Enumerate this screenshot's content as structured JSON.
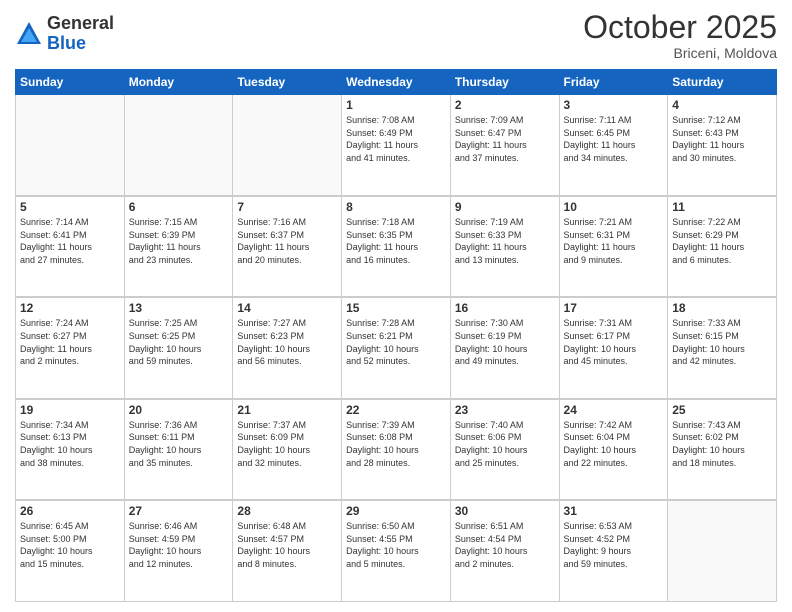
{
  "logo": {
    "general": "General",
    "blue": "Blue"
  },
  "title": "October 2025",
  "location": "Briceni, Moldova",
  "days_of_week": [
    "Sunday",
    "Monday",
    "Tuesday",
    "Wednesday",
    "Thursday",
    "Friday",
    "Saturday"
  ],
  "weeks": [
    [
      {
        "day": "",
        "info": ""
      },
      {
        "day": "",
        "info": ""
      },
      {
        "day": "",
        "info": ""
      },
      {
        "day": "1",
        "info": "Sunrise: 7:08 AM\nSunset: 6:49 PM\nDaylight: 11 hours\nand 41 minutes."
      },
      {
        "day": "2",
        "info": "Sunrise: 7:09 AM\nSunset: 6:47 PM\nDaylight: 11 hours\nand 37 minutes."
      },
      {
        "day": "3",
        "info": "Sunrise: 7:11 AM\nSunset: 6:45 PM\nDaylight: 11 hours\nand 34 minutes."
      },
      {
        "day": "4",
        "info": "Sunrise: 7:12 AM\nSunset: 6:43 PM\nDaylight: 11 hours\nand 30 minutes."
      }
    ],
    [
      {
        "day": "5",
        "info": "Sunrise: 7:14 AM\nSunset: 6:41 PM\nDaylight: 11 hours\nand 27 minutes."
      },
      {
        "day": "6",
        "info": "Sunrise: 7:15 AM\nSunset: 6:39 PM\nDaylight: 11 hours\nand 23 minutes."
      },
      {
        "day": "7",
        "info": "Sunrise: 7:16 AM\nSunset: 6:37 PM\nDaylight: 11 hours\nand 20 minutes."
      },
      {
        "day": "8",
        "info": "Sunrise: 7:18 AM\nSunset: 6:35 PM\nDaylight: 11 hours\nand 16 minutes."
      },
      {
        "day": "9",
        "info": "Sunrise: 7:19 AM\nSunset: 6:33 PM\nDaylight: 11 hours\nand 13 minutes."
      },
      {
        "day": "10",
        "info": "Sunrise: 7:21 AM\nSunset: 6:31 PM\nDaylight: 11 hours\nand 9 minutes."
      },
      {
        "day": "11",
        "info": "Sunrise: 7:22 AM\nSunset: 6:29 PM\nDaylight: 11 hours\nand 6 minutes."
      }
    ],
    [
      {
        "day": "12",
        "info": "Sunrise: 7:24 AM\nSunset: 6:27 PM\nDaylight: 11 hours\nand 2 minutes."
      },
      {
        "day": "13",
        "info": "Sunrise: 7:25 AM\nSunset: 6:25 PM\nDaylight: 10 hours\nand 59 minutes."
      },
      {
        "day": "14",
        "info": "Sunrise: 7:27 AM\nSunset: 6:23 PM\nDaylight: 10 hours\nand 56 minutes."
      },
      {
        "day": "15",
        "info": "Sunrise: 7:28 AM\nSunset: 6:21 PM\nDaylight: 10 hours\nand 52 minutes."
      },
      {
        "day": "16",
        "info": "Sunrise: 7:30 AM\nSunset: 6:19 PM\nDaylight: 10 hours\nand 49 minutes."
      },
      {
        "day": "17",
        "info": "Sunrise: 7:31 AM\nSunset: 6:17 PM\nDaylight: 10 hours\nand 45 minutes."
      },
      {
        "day": "18",
        "info": "Sunrise: 7:33 AM\nSunset: 6:15 PM\nDaylight: 10 hours\nand 42 minutes."
      }
    ],
    [
      {
        "day": "19",
        "info": "Sunrise: 7:34 AM\nSunset: 6:13 PM\nDaylight: 10 hours\nand 38 minutes."
      },
      {
        "day": "20",
        "info": "Sunrise: 7:36 AM\nSunset: 6:11 PM\nDaylight: 10 hours\nand 35 minutes."
      },
      {
        "day": "21",
        "info": "Sunrise: 7:37 AM\nSunset: 6:09 PM\nDaylight: 10 hours\nand 32 minutes."
      },
      {
        "day": "22",
        "info": "Sunrise: 7:39 AM\nSunset: 6:08 PM\nDaylight: 10 hours\nand 28 minutes."
      },
      {
        "day": "23",
        "info": "Sunrise: 7:40 AM\nSunset: 6:06 PM\nDaylight: 10 hours\nand 25 minutes."
      },
      {
        "day": "24",
        "info": "Sunrise: 7:42 AM\nSunset: 6:04 PM\nDaylight: 10 hours\nand 22 minutes."
      },
      {
        "day": "25",
        "info": "Sunrise: 7:43 AM\nSunset: 6:02 PM\nDaylight: 10 hours\nand 18 minutes."
      }
    ],
    [
      {
        "day": "26",
        "info": "Sunrise: 6:45 AM\nSunset: 5:00 PM\nDaylight: 10 hours\nand 15 minutes."
      },
      {
        "day": "27",
        "info": "Sunrise: 6:46 AM\nSunset: 4:59 PM\nDaylight: 10 hours\nand 12 minutes."
      },
      {
        "day": "28",
        "info": "Sunrise: 6:48 AM\nSunset: 4:57 PM\nDaylight: 10 hours\nand 8 minutes."
      },
      {
        "day": "29",
        "info": "Sunrise: 6:50 AM\nSunset: 4:55 PM\nDaylight: 10 hours\nand 5 minutes."
      },
      {
        "day": "30",
        "info": "Sunrise: 6:51 AM\nSunset: 4:54 PM\nDaylight: 10 hours\nand 2 minutes."
      },
      {
        "day": "31",
        "info": "Sunrise: 6:53 AM\nSunset: 4:52 PM\nDaylight: 9 hours\nand 59 minutes."
      },
      {
        "day": "",
        "info": ""
      }
    ]
  ]
}
